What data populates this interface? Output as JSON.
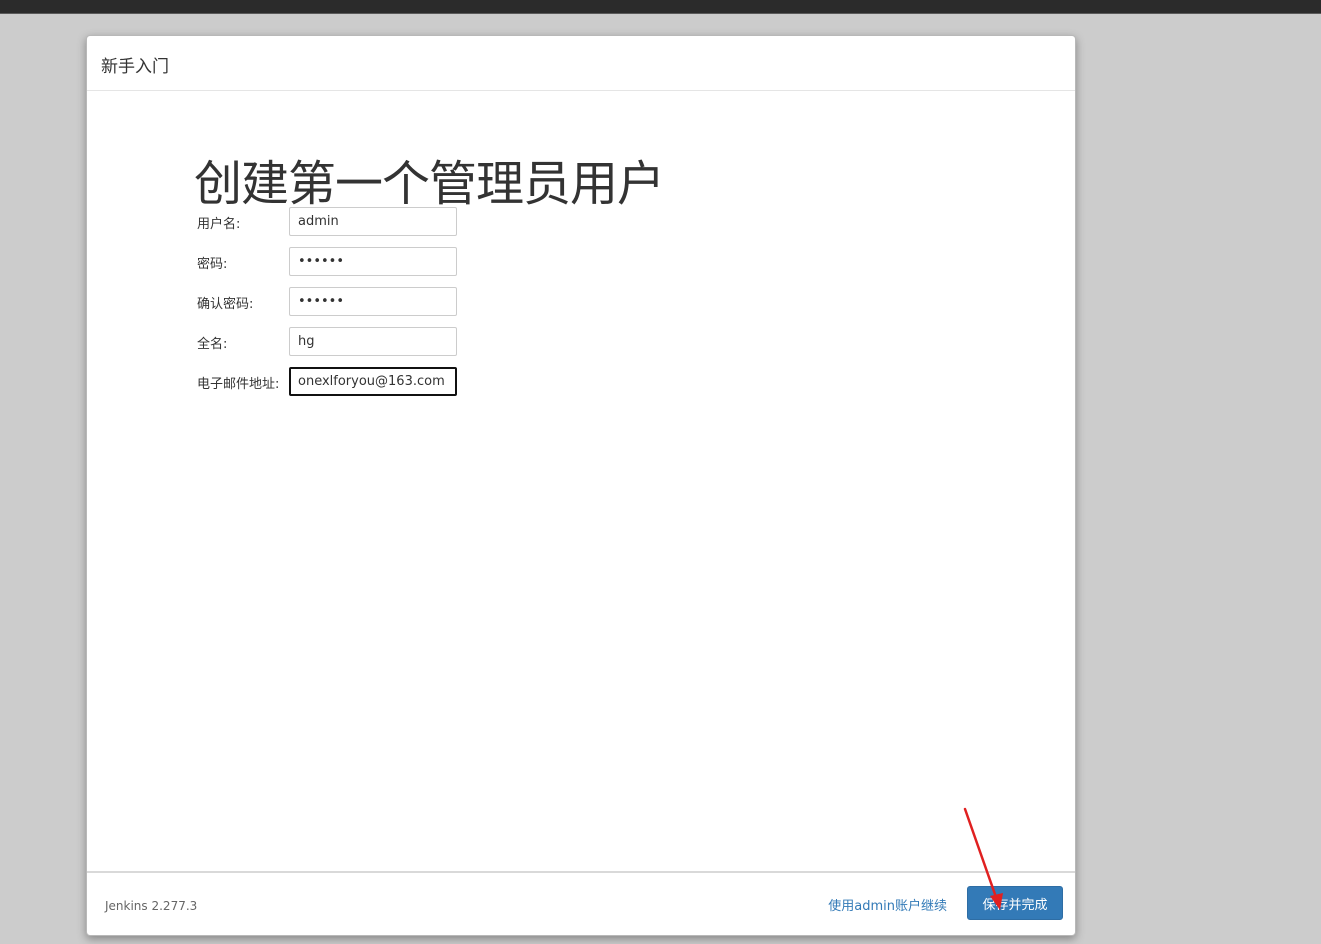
{
  "dialog": {
    "title": "新手入门",
    "heading": "创建第一个管理员用户"
  },
  "form": {
    "fields": [
      {
        "label": "用户名:",
        "value": "admin",
        "type": "text"
      },
      {
        "label": "密码:",
        "value": "••••••",
        "type": "password"
      },
      {
        "label": "确认密码:",
        "value": "••••••",
        "type": "password"
      },
      {
        "label": "全名:",
        "value": "hg",
        "type": "text"
      },
      {
        "label": "电子邮件地址:",
        "value": "onexlforyou@163.com",
        "type": "text"
      }
    ]
  },
  "footer": {
    "version": "Jenkins 2.277.3",
    "continue_link": "使用admin账户继续",
    "save_button": "保存并完成"
  },
  "colors": {
    "accent": "#337ab7",
    "annotation_arrow": "#e02020"
  }
}
